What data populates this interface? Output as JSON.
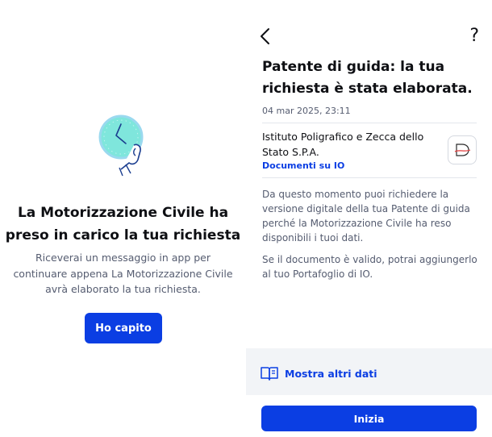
{
  "left_screen": {
    "title": "La Motorizzazione Civile ha preso in carico la tua richiesta",
    "body": "Riceverai un messaggio in app per continuare appena La Motorizzazione Civile avrà elaborato la tua richiesta.",
    "button_label": "Ho capito",
    "illustration_icon": "clock-hand-icon"
  },
  "right_screen": {
    "help_glyph": "?",
    "message": {
      "title": "Patente di guida: la tua richiesta è stata elaborata.",
      "date": "04 mar 2025, 23:11",
      "sender": "Istituto Poligrafico e Zecca dello Stato S.P.A.",
      "sender_link": "Documenti su IO",
      "paragraphs": [
        "Da questo momento puoi richiedere la versione digitale della tua Patente di guida perché la Motorizzazione Civile ha reso disponibili i tuoi dati.",
        "Se il documento è valido, potrai aggiungerlo al tuo Portafoglio di IO."
      ]
    },
    "more_data_label": "Mostra altri dati",
    "start_button_label": "Inizia"
  },
  "colors": {
    "primary": "#0b3ee3",
    "text": "#0e0f13",
    "muted": "#555c70",
    "panel": "#f2f4f7",
    "illustration": "#6ee0d6"
  }
}
